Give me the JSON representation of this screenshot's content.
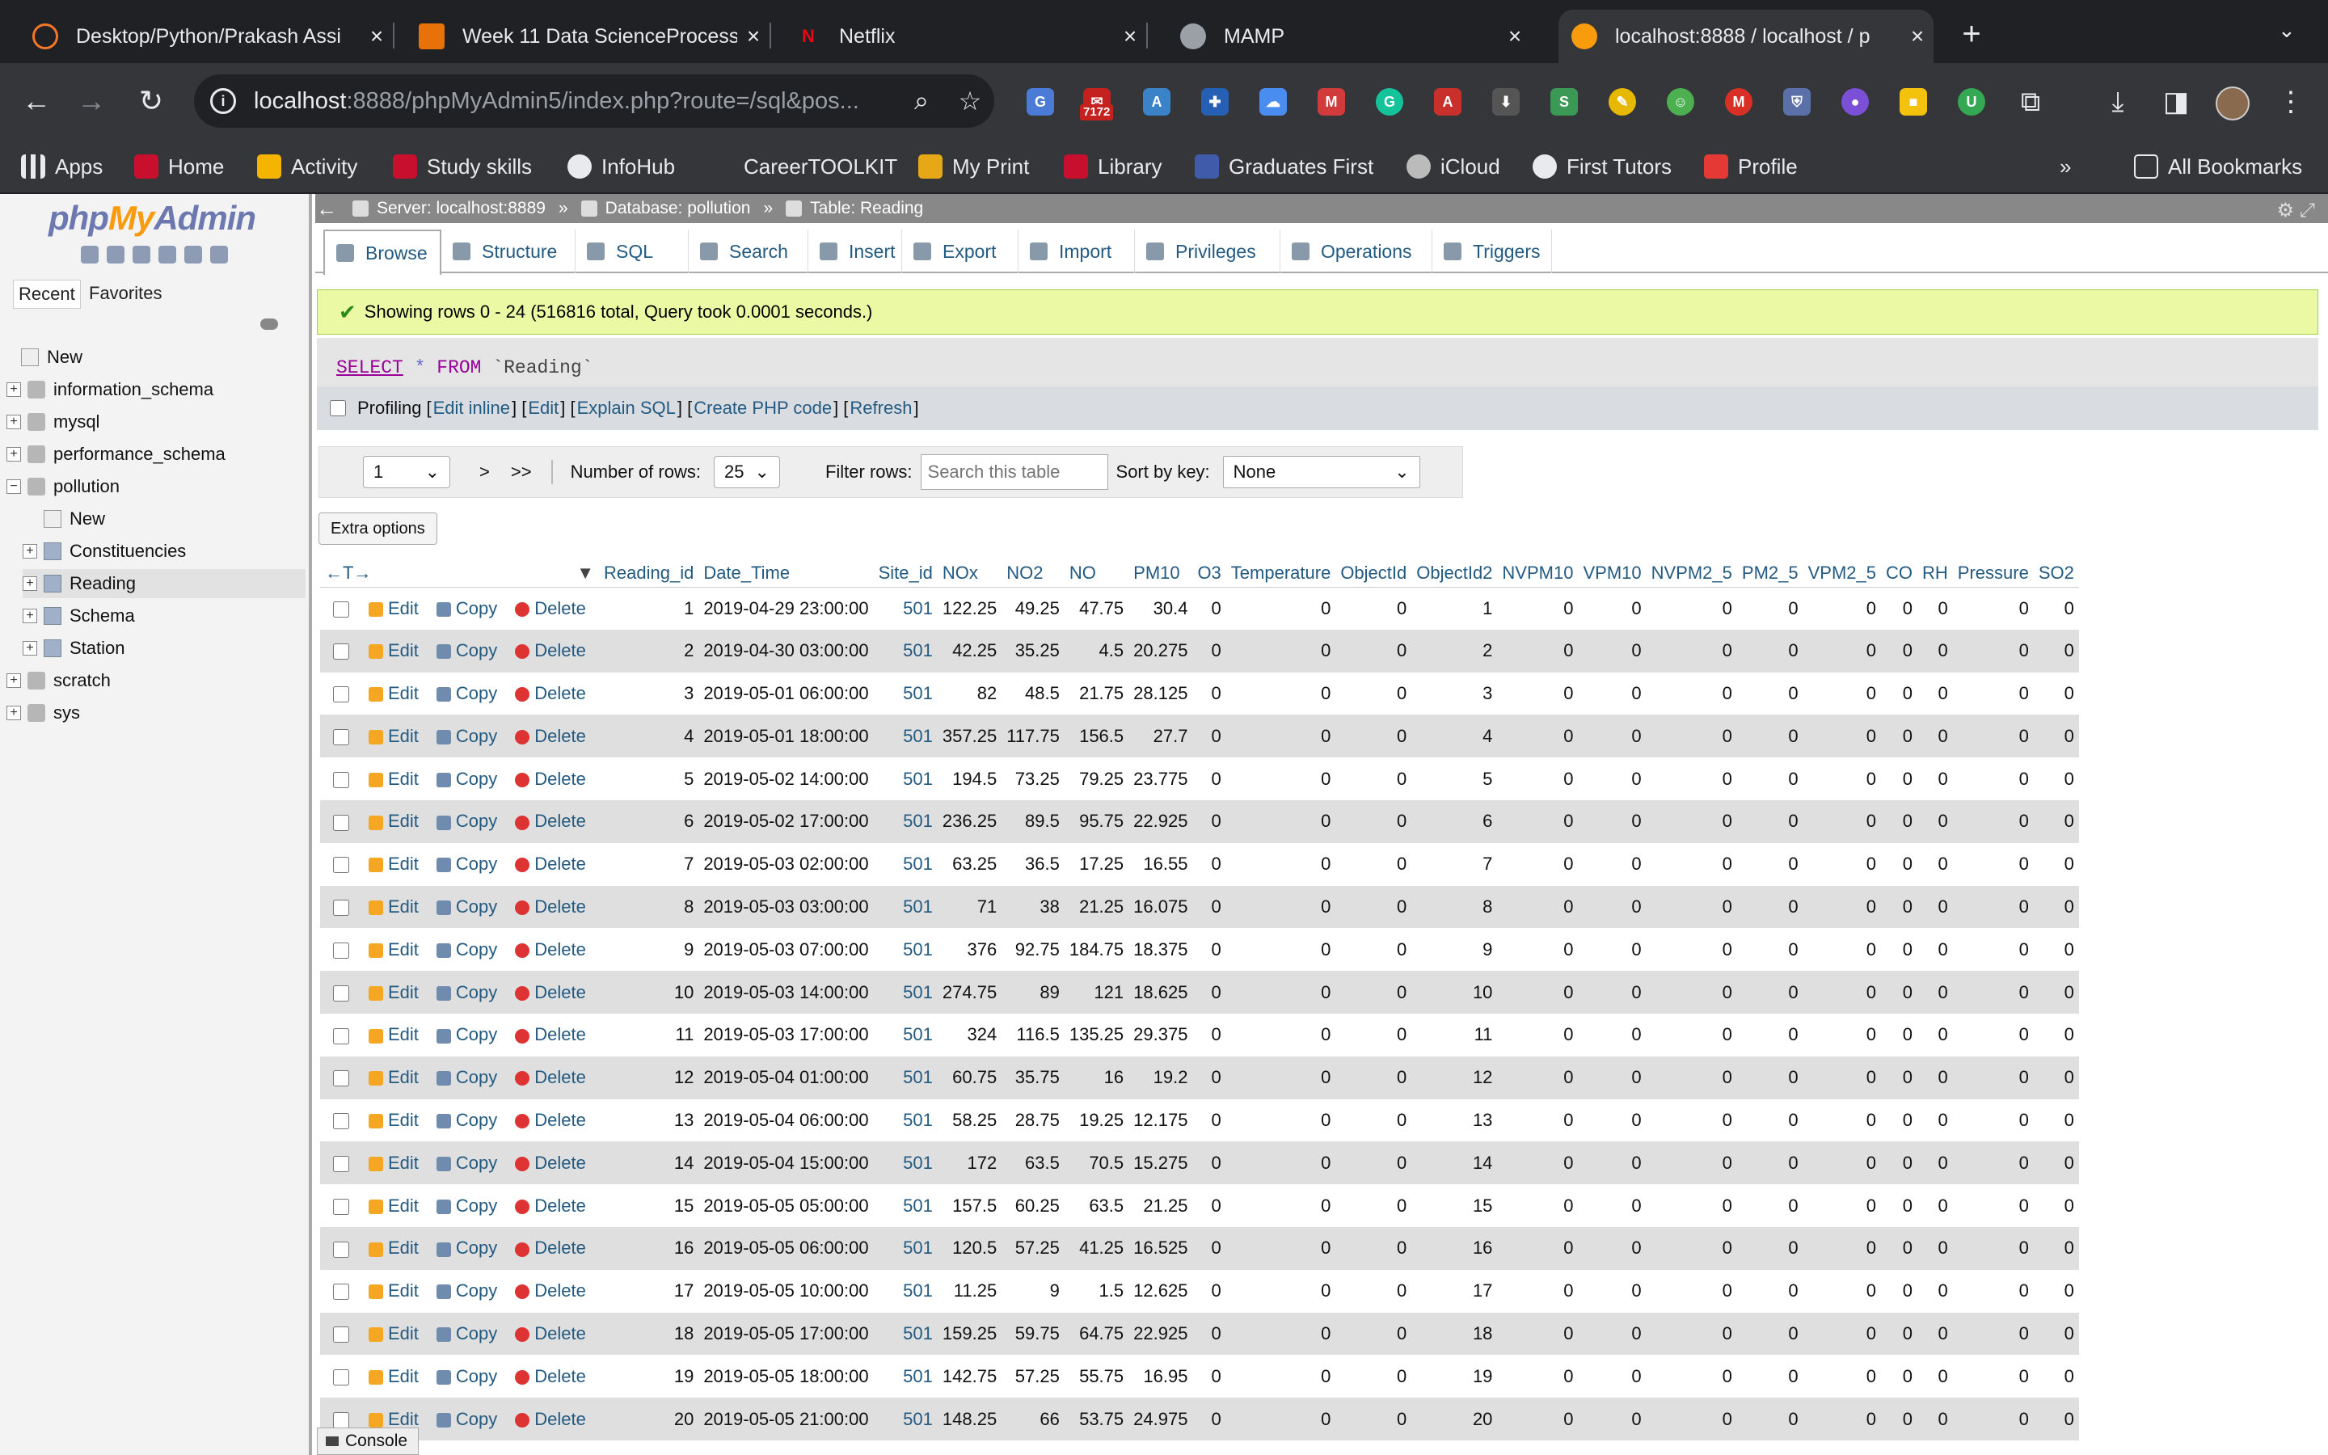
{
  "browser": {
    "tabs": [
      {
        "title": "Desktop/Python/Prakash Assi",
        "icon": "jupyter-icon",
        "color": "#f37726"
      },
      {
        "title": "Week 11 Data ScienceProcess",
        "icon": "notebook-icon",
        "color": "#e8710a"
      },
      {
        "title": "Netflix",
        "icon": "netflix-icon",
        "color": "#e50914"
      },
      {
        "title": "MAMP",
        "icon": "mamp-icon",
        "color": "#9aa0a6"
      },
      {
        "title": "localhost:8888 / localhost / p",
        "icon": "phpmyadmin-icon",
        "color": "#f89c0e"
      }
    ],
    "url_host": "localhost",
    "url_path": ":8888/phpMyAdmin5/index.php?route=/sql&pos...",
    "extension_badge": "7172",
    "bookmarks": [
      {
        "label": "Apps"
      },
      {
        "label": "Home"
      },
      {
        "label": "Activity"
      },
      {
        "label": "Study skills"
      },
      {
        "label": "InfoHub"
      },
      {
        "label": "CareerTOOLKIT"
      },
      {
        "label": "My Print"
      },
      {
        "label": "Library"
      },
      {
        "label": "Graduates First"
      },
      {
        "label": "iCloud"
      },
      {
        "label": "First Tutors"
      },
      {
        "label": "Profile"
      }
    ],
    "all_bookmarks": "All Bookmarks"
  },
  "nav": {
    "logo_php": "php",
    "logo_my": "My",
    "logo_admin": "Admin",
    "recent": "Recent",
    "favorites": "Favorites",
    "tree": [
      {
        "label": "New",
        "level": 0,
        "kind": "new"
      },
      {
        "label": "information_schema",
        "level": 0,
        "kind": "db"
      },
      {
        "label": "mysql",
        "level": 0,
        "kind": "db"
      },
      {
        "label": "performance_schema",
        "level": 0,
        "kind": "db"
      },
      {
        "label": "pollution",
        "level": 0,
        "kind": "db",
        "expanded": true
      },
      {
        "label": "New",
        "level": 1,
        "kind": "new"
      },
      {
        "label": "Constituencies",
        "level": 1,
        "kind": "table"
      },
      {
        "label": "Reading",
        "level": 1,
        "kind": "table",
        "selected": true
      },
      {
        "label": "Schema",
        "level": 1,
        "kind": "table"
      },
      {
        "label": "Station",
        "level": 1,
        "kind": "table"
      },
      {
        "label": "scratch",
        "level": 0,
        "kind": "db"
      },
      {
        "label": "sys",
        "level": 0,
        "kind": "db"
      }
    ]
  },
  "breadcrumb": {
    "server": "Server: localhost:8889",
    "database": "Database: pollution",
    "table": "Table: Reading"
  },
  "menu_tabs": [
    "Browse",
    "Structure",
    "SQL",
    "Search",
    "Insert",
    "Export",
    "Import",
    "Privileges",
    "Operations",
    "Triggers"
  ],
  "message": "Showing rows 0 - 24 (516816 total, Query took 0.0001 seconds.)",
  "sql": {
    "select": "SELECT",
    "star": "*",
    "from": "FROM",
    "table": "`Reading`"
  },
  "profiling": {
    "label": "Profiling",
    "links": [
      "Edit inline",
      "Edit",
      "Explain SQL",
      "Create PHP code",
      "Refresh"
    ]
  },
  "pager": {
    "page": "1",
    "next": ">",
    "last": ">>",
    "rows_label": "Number of rows:",
    "rows_value": "25",
    "filter_label": "Filter rows:",
    "filter_placeholder": "Search this table",
    "sort_label": "Sort by key:",
    "sort_value": "None"
  },
  "extra_options": "Extra options",
  "columns": [
    "Reading_id",
    "Date_Time",
    "Site_id",
    "NOx",
    "NO2",
    "NO",
    "PM10",
    "O3",
    "Temperature",
    "ObjectId",
    "ObjectId2",
    "NVPM10",
    "VPM10",
    "NVPM2_5",
    "PM2_5",
    "VPM2_5",
    "CO",
    "RH",
    "Pressure",
    "SO2"
  ],
  "row_actions": {
    "edit": "Edit",
    "copy": "Copy",
    "delete": "Delete"
  },
  "rows": [
    [
      "1",
      "2019-04-29 23:00:00",
      "501",
      "122.25",
      "49.25",
      "47.75",
      "30.4",
      "0",
      "0",
      "0",
      "1",
      "0",
      "0",
      "0",
      "0",
      "0",
      "0",
      "0",
      "0",
      "0"
    ],
    [
      "2",
      "2019-04-30 03:00:00",
      "501",
      "42.25",
      "35.25",
      "4.5",
      "20.275",
      "0",
      "0",
      "0",
      "2",
      "0",
      "0",
      "0",
      "0",
      "0",
      "0",
      "0",
      "0",
      "0"
    ],
    [
      "3",
      "2019-05-01 06:00:00",
      "501",
      "82",
      "48.5",
      "21.75",
      "28.125",
      "0",
      "0",
      "0",
      "3",
      "0",
      "0",
      "0",
      "0",
      "0",
      "0",
      "0",
      "0",
      "0"
    ],
    [
      "4",
      "2019-05-01 18:00:00",
      "501",
      "357.25",
      "117.75",
      "156.5",
      "27.7",
      "0",
      "0",
      "0",
      "4",
      "0",
      "0",
      "0",
      "0",
      "0",
      "0",
      "0",
      "0",
      "0"
    ],
    [
      "5",
      "2019-05-02 14:00:00",
      "501",
      "194.5",
      "73.25",
      "79.25",
      "23.775",
      "0",
      "0",
      "0",
      "5",
      "0",
      "0",
      "0",
      "0",
      "0",
      "0",
      "0",
      "0",
      "0"
    ],
    [
      "6",
      "2019-05-02 17:00:00",
      "501",
      "236.25",
      "89.5",
      "95.75",
      "22.925",
      "0",
      "0",
      "0",
      "6",
      "0",
      "0",
      "0",
      "0",
      "0",
      "0",
      "0",
      "0",
      "0"
    ],
    [
      "7",
      "2019-05-03 02:00:00",
      "501",
      "63.25",
      "36.5",
      "17.25",
      "16.55",
      "0",
      "0",
      "0",
      "7",
      "0",
      "0",
      "0",
      "0",
      "0",
      "0",
      "0",
      "0",
      "0"
    ],
    [
      "8",
      "2019-05-03 03:00:00",
      "501",
      "71",
      "38",
      "21.25",
      "16.075",
      "0",
      "0",
      "0",
      "8",
      "0",
      "0",
      "0",
      "0",
      "0",
      "0",
      "0",
      "0",
      "0"
    ],
    [
      "9",
      "2019-05-03 07:00:00",
      "501",
      "376",
      "92.75",
      "184.75",
      "18.375",
      "0",
      "0",
      "0",
      "9",
      "0",
      "0",
      "0",
      "0",
      "0",
      "0",
      "0",
      "0",
      "0"
    ],
    [
      "10",
      "2019-05-03 14:00:00",
      "501",
      "274.75",
      "89",
      "121",
      "18.625",
      "0",
      "0",
      "0",
      "10",
      "0",
      "0",
      "0",
      "0",
      "0",
      "0",
      "0",
      "0",
      "0"
    ],
    [
      "11",
      "2019-05-03 17:00:00",
      "501",
      "324",
      "116.5",
      "135.25",
      "29.375",
      "0",
      "0",
      "0",
      "11",
      "0",
      "0",
      "0",
      "0",
      "0",
      "0",
      "0",
      "0",
      "0"
    ],
    [
      "12",
      "2019-05-04 01:00:00",
      "501",
      "60.75",
      "35.75",
      "16",
      "19.2",
      "0",
      "0",
      "0",
      "12",
      "0",
      "0",
      "0",
      "0",
      "0",
      "0",
      "0",
      "0",
      "0"
    ],
    [
      "13",
      "2019-05-04 06:00:00",
      "501",
      "58.25",
      "28.75",
      "19.25",
      "12.175",
      "0",
      "0",
      "0",
      "13",
      "0",
      "0",
      "0",
      "0",
      "0",
      "0",
      "0",
      "0",
      "0"
    ],
    [
      "14",
      "2019-05-04 15:00:00",
      "501",
      "172",
      "63.5",
      "70.5",
      "15.275",
      "0",
      "0",
      "0",
      "14",
      "0",
      "0",
      "0",
      "0",
      "0",
      "0",
      "0",
      "0",
      "0"
    ],
    [
      "15",
      "2019-05-05 05:00:00",
      "501",
      "157.5",
      "60.25",
      "63.5",
      "21.25",
      "0",
      "0",
      "0",
      "15",
      "0",
      "0",
      "0",
      "0",
      "0",
      "0",
      "0",
      "0",
      "0"
    ],
    [
      "16",
      "2019-05-05 06:00:00",
      "501",
      "120.5",
      "57.25",
      "41.25",
      "16.525",
      "0",
      "0",
      "0",
      "16",
      "0",
      "0",
      "0",
      "0",
      "0",
      "0",
      "0",
      "0",
      "0"
    ],
    [
      "17",
      "2019-05-05 10:00:00",
      "501",
      "11.25",
      "9",
      "1.5",
      "12.625",
      "0",
      "0",
      "0",
      "17",
      "0",
      "0",
      "0",
      "0",
      "0",
      "0",
      "0",
      "0",
      "0"
    ],
    [
      "18",
      "2019-05-05 17:00:00",
      "501",
      "159.25",
      "59.75",
      "64.75",
      "22.925",
      "0",
      "0",
      "0",
      "18",
      "0",
      "0",
      "0",
      "0",
      "0",
      "0",
      "0",
      "0",
      "0"
    ],
    [
      "19",
      "2019-05-05 18:00:00",
      "501",
      "142.75",
      "57.25",
      "55.75",
      "16.95",
      "0",
      "0",
      "0",
      "19",
      "0",
      "0",
      "0",
      "0",
      "0",
      "0",
      "0",
      "0",
      "0"
    ],
    [
      "20",
      "2019-05-05 21:00:00",
      "501",
      "148.25",
      "66",
      "53.75",
      "24.975",
      "0",
      "0",
      "0",
      "20",
      "0",
      "0",
      "0",
      "0",
      "0",
      "0",
      "0",
      "0",
      "0"
    ]
  ],
  "console": "Console"
}
